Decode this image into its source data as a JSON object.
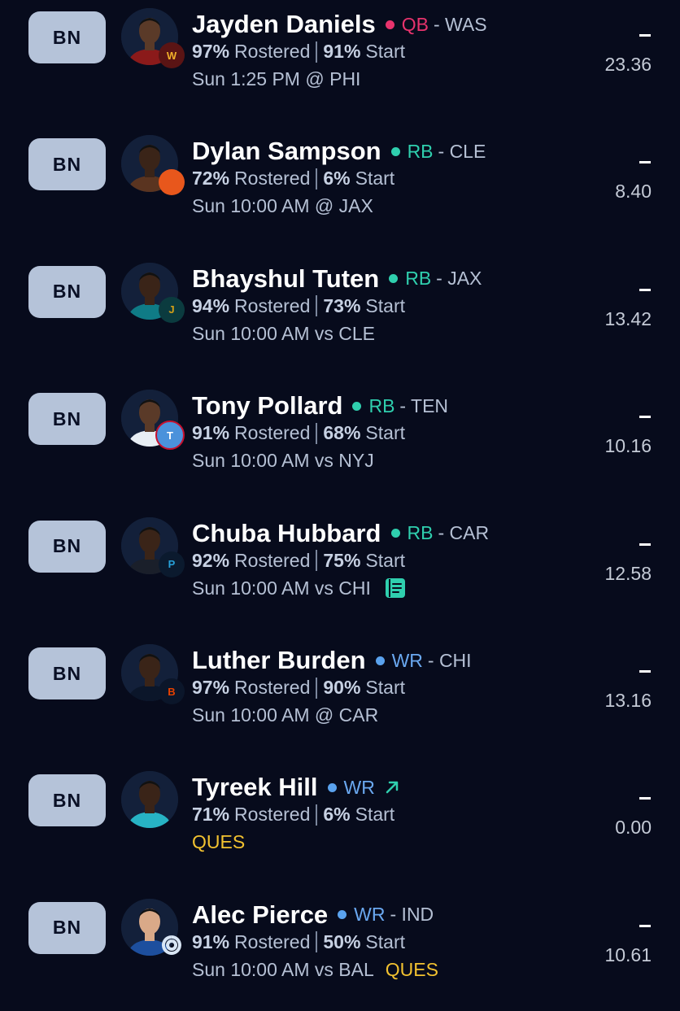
{
  "players": [
    {
      "slot": "BN",
      "name": "Jayden Daniels",
      "position": "QB",
      "team": "WAS",
      "dot_color": "#e8336d",
      "pos_color": "#e8336d",
      "rostered_pct": "97%",
      "rostered_label": "Rostered",
      "start_pct": "91%",
      "start_label": "Start",
      "game": "Sun 1:25 PM @ PHI",
      "projection": "-",
      "score": "23.36",
      "logo_icon": "commanders-logo-icon",
      "logo_text": "W",
      "logo_bg": "#5a1414",
      "logo_fg": "#f0b02a",
      "jersey": "#8b1a1a",
      "skin": "#5a3a28"
    },
    {
      "slot": "BN",
      "name": "Dylan Sampson",
      "position": "RB",
      "team": "CLE",
      "dot_color": "#2fcfae",
      "pos_color": "#2fcfae",
      "rostered_pct": "72%",
      "rostered_label": "Rostered",
      "start_pct": "6%",
      "start_label": "Start",
      "game": "Sun 10:00 AM @ JAX",
      "projection": "-",
      "score": "8.40",
      "logo_icon": "browns-helmet-icon",
      "logo_text": "",
      "logo_bg": "#e8571c",
      "logo_fg": "#ffffff",
      "jersey": "#5a3420",
      "skin": "#3a2418"
    },
    {
      "slot": "BN",
      "name": "Bhayshul Tuten",
      "position": "RB",
      "team": "JAX",
      "dot_color": "#2fcfae",
      "pos_color": "#2fcfae",
      "rostered_pct": "94%",
      "rostered_label": "Rostered",
      "start_pct": "73%",
      "start_label": "Start",
      "game": "Sun 10:00 AM vs CLE",
      "projection": "-",
      "score": "13.42",
      "logo_icon": "jaguars-logo-icon",
      "logo_text": "J",
      "logo_bg": "#0b3b3f",
      "logo_fg": "#d4a017",
      "jersey": "#0f7b86",
      "skin": "#3a2418"
    },
    {
      "slot": "BN",
      "name": "Tony Pollard",
      "position": "RB",
      "team": "TEN",
      "dot_color": "#2fcfae",
      "pos_color": "#2fcfae",
      "rostered_pct": "91%",
      "rostered_label": "Rostered",
      "start_pct": "68%",
      "start_label": "Start",
      "game": "Sun 10:00 AM vs NYJ",
      "projection": "-",
      "score": "10.16",
      "logo_icon": "titans-logo-icon",
      "logo_text": "T",
      "logo_bg": "#4b92db",
      "logo_fg": "#ffffff",
      "jersey": "#e8eef4",
      "skin": "#5a3a28"
    },
    {
      "slot": "BN",
      "name": "Chuba Hubbard",
      "position": "RB",
      "team": "CAR",
      "dot_color": "#2fcfae",
      "pos_color": "#2fcfae",
      "rostered_pct": "92%",
      "rostered_label": "Rostered",
      "start_pct": "75%",
      "start_label": "Start",
      "game": "Sun 10:00 AM vs CHI",
      "projection": "-",
      "score": "12.58",
      "logo_icon": "panthers-logo-icon",
      "logo_text": "P",
      "logo_bg": "#0b1a2e",
      "logo_fg": "#27a0d8",
      "jersey": "#1a1f2a",
      "skin": "#3a2418",
      "note_icon": true
    },
    {
      "slot": "BN",
      "name": "Luther Burden",
      "position": "WR",
      "team": "CHI",
      "dot_color": "#5aa2ee",
      "pos_color": "#6aa8f0",
      "rostered_pct": "97%",
      "rostered_label": "Rostered",
      "start_pct": "90%",
      "start_label": "Start",
      "game": "Sun 10:00 AM @ CAR",
      "projection": "-",
      "score": "13.16",
      "logo_icon": "bears-logo-icon",
      "logo_text": "B",
      "logo_bg": "#0b162a",
      "logo_fg": "#e64100",
      "jersey": "#0b162a",
      "skin": "#3a2418"
    },
    {
      "slot": "BN",
      "name": "Tyreek Hill",
      "position": "WR",
      "team": "",
      "dot_color": "#5aa2ee",
      "pos_color": "#6aa8f0",
      "rostered_pct": "71%",
      "rostered_label": "Rostered",
      "start_pct": "6%",
      "start_label": "Start",
      "game": "",
      "status": "QUES",
      "projection": "-",
      "score": "0.00",
      "logo_icon": "",
      "logo_text": "",
      "jersey": "#27b3c4",
      "skin": "#3a2418",
      "trend_icon": true
    },
    {
      "slot": "BN",
      "name": "Alec Pierce",
      "position": "WR",
      "team": "IND",
      "dot_color": "#5aa2ee",
      "pos_color": "#6aa8f0",
      "rostered_pct": "91%",
      "rostered_label": "Rostered",
      "start_pct": "50%",
      "start_label": "Start",
      "game": "Sun 10:00 AM vs BAL",
      "status": "QUES",
      "projection": "-",
      "score": "10.61",
      "logo_icon": "colts-logo-icon",
      "logo_text": "",
      "logo_bg": "transparent",
      "logo_fg": "#d9e6f5",
      "jersey": "#1d4f9e",
      "skin": "#d9a988"
    }
  ]
}
